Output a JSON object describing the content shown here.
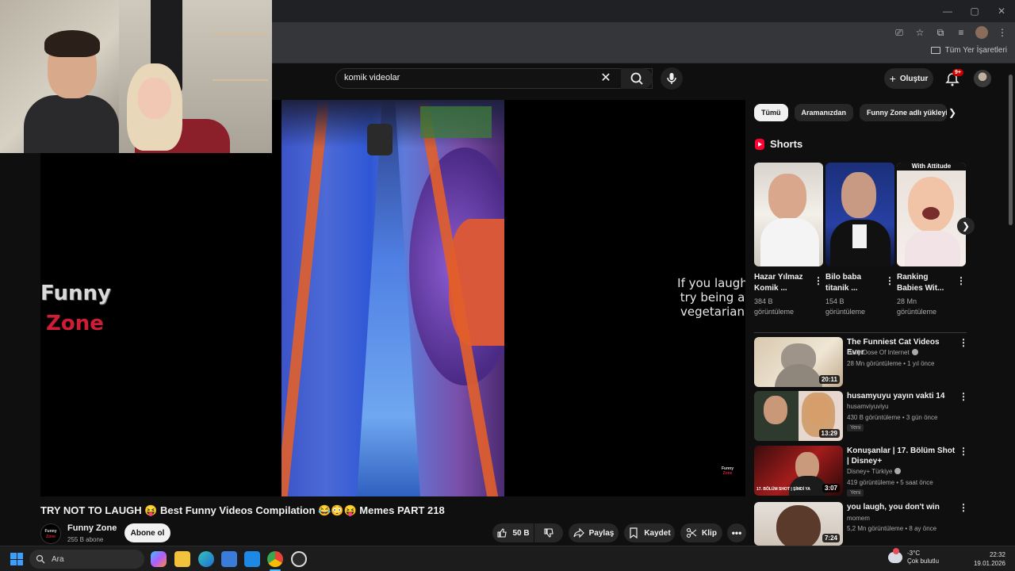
{
  "browser": {
    "window_controls": [
      "—",
      "▢",
      "✕"
    ],
    "bookmarks_all": "Tüm Yer İşaretleri"
  },
  "search": {
    "value": "komik videolar"
  },
  "header": {
    "create_label": "Oluştur",
    "notif_badge": "9+"
  },
  "video": {
    "channel_logo_line1": "Funny",
    "channel_logo_line2": "Zone",
    "caption": "If you laugh try being a vegetarian",
    "watermark_line1": "Funny",
    "watermark_line2": "Zone",
    "title": "TRY NOT TO LAUGH 😝 Best Funny Videos Compilation 😂😳😝 Memes PART 218",
    "channel_name": "Funny Zone",
    "subscribers": "255 B abone",
    "subscribe_label": "Abone ol",
    "likes": "50 B",
    "share_label": "Paylaş",
    "save_label": "Kaydet",
    "clip_label": "Klip"
  },
  "chips": [
    "Tümü",
    "Aramanızdan",
    "Funny Zone adlı yükleyici"
  ],
  "shorts": {
    "heading": "Shorts",
    "items": [
      {
        "title": "Hazar Yılmaz Komik ...",
        "views": "384 B görüntüleme"
      },
      {
        "title": "Bilo baba titanik ...",
        "views": "154 B görüntüleme"
      },
      {
        "title": "Ranking Babies Wit...",
        "views": "28 Mn görüntüleme",
        "overlay": "With Attitude"
      }
    ]
  },
  "recommendations": [
    {
      "title": "The Funniest Cat Videos Ever",
      "channel": "Daily Dose Of Internet",
      "meta": "28 Mn görüntüleme • 1 yıl önce",
      "duration": "20:11",
      "verified": true
    },
    {
      "title": "husamyuyu yayın vakti 14",
      "channel": "husamviyuviyu",
      "meta": "430 B görüntüleme • 3 gün önce",
      "duration": "13:29",
      "badge": "Yeni"
    },
    {
      "title": "Konuşanlar | 17. Bölüm Shot | Disney+",
      "channel": "Disney+ Türkiye",
      "meta": "419 görüntüleme • 5 saat önce",
      "duration": "3:07",
      "badge": "Yeni",
      "verified": true,
      "thumb_text": "17. BÖLÜM SHOT | ŞİMDİ YA"
    },
    {
      "title": "you laugh, you don't win",
      "channel": "momem",
      "meta": "5,2 Mn görüntüleme • 8 ay önce",
      "duration": "7:24"
    }
  ],
  "taskbar": {
    "search_placeholder": "Ara",
    "temperature": "-3°C",
    "weather": "Çok bulutlu",
    "time": "22:32",
    "date": "19.01.2026"
  }
}
